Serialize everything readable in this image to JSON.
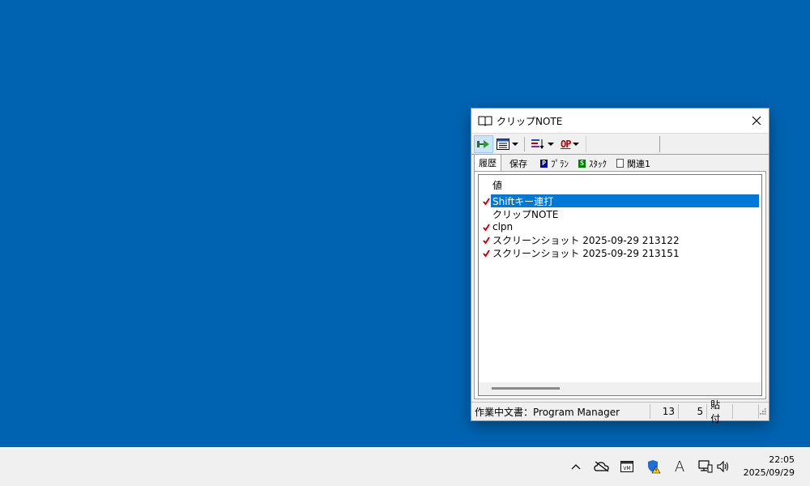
{
  "window": {
    "title": "クリップNOTE",
    "tabs": [
      {
        "label": "履歴",
        "icon": "none"
      },
      {
        "label": "保存",
        "icon": "none"
      },
      {
        "label": "ﾌﾟﾗﾝ",
        "icon": "P"
      },
      {
        "label": "ｽﾀｯｸ",
        "icon": "S"
      },
      {
        "label": "関連1",
        "icon": "doc"
      }
    ],
    "toolbar": {
      "op_label": "OP"
    },
    "list": {
      "column_header": "値",
      "rows": [
        {
          "text": "Shiftキー連打",
          "checked": true,
          "selected": true
        },
        {
          "text": "クリップNOTE",
          "checked": false,
          "selected": false
        },
        {
          "text": "clpn",
          "checked": true,
          "selected": false
        },
        {
          "text": "スクリーンショット 2025-09-29 213122",
          "checked": true,
          "selected": false
        },
        {
          "text": "スクリーンショット 2025-09-29 213151",
          "checked": true,
          "selected": false
        }
      ]
    },
    "status": {
      "document": "作業中文書：Program Manager",
      "count": "13",
      "number": "5",
      "mode": "貼付"
    }
  },
  "taskbar": {
    "time": "22:05",
    "date": "2025/09/29",
    "ime_label": "A",
    "tray_icons": [
      "chevron-up-icon",
      "onedrive-offline-icon",
      "vm-icon",
      "defender-warning-icon",
      "ime-icon",
      "network-icon",
      "volume-icon"
    ]
  },
  "colors": {
    "desktop": "#0063b1",
    "selection": "#0078d7",
    "check": "#d00000"
  }
}
